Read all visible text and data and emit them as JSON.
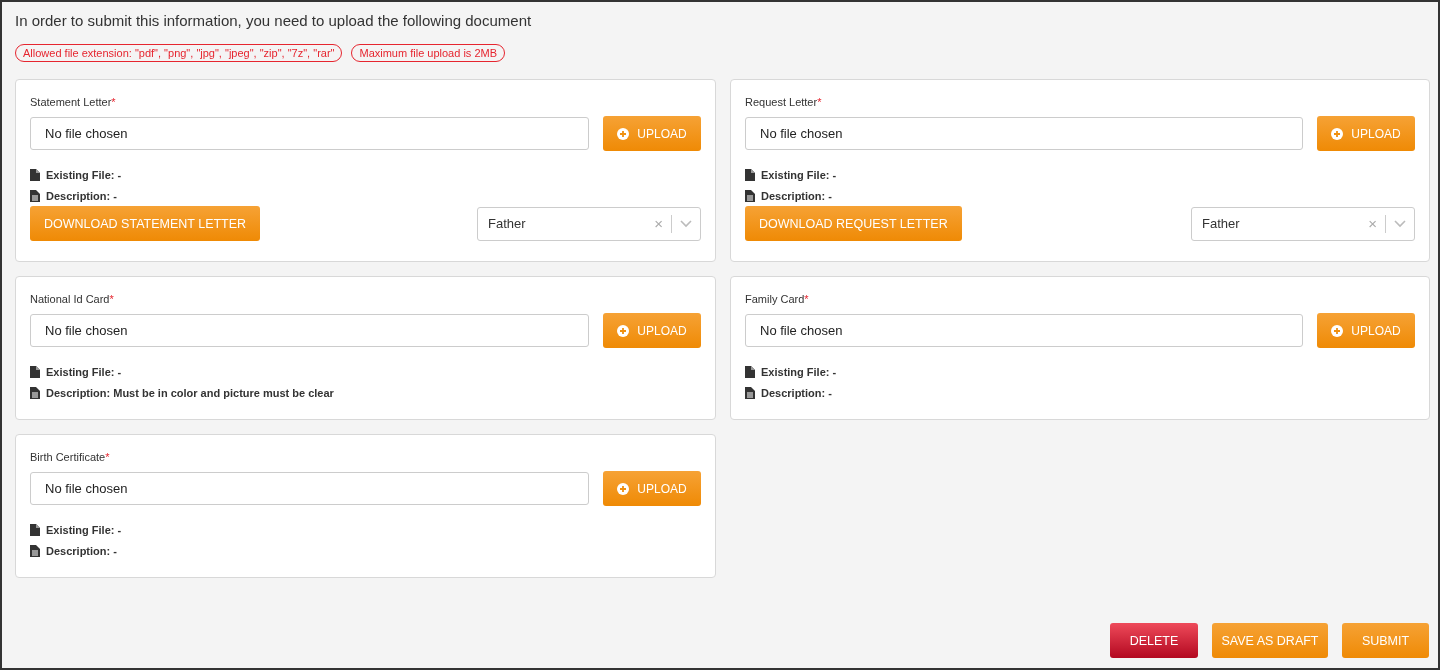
{
  "intro": "In order to submit this information, you need to upload the following document",
  "notices": [
    "Allowed file extension: \"pdf\", \"png\", \"jpg\", \"jpeg\", \"zip\", \"7z\", \"rar\"",
    "Maximum file upload is 2MB"
  ],
  "documents": [
    {
      "label": "Statement Letter",
      "required_mark": "*",
      "file_field": "No file chosen",
      "upload_button": "UPLOAD",
      "existing_file": "Existing File: -",
      "description": "Description: -",
      "download_button": "DOWNLOAD STATEMENT LETTER",
      "select_value": "Father",
      "select_clear": "×"
    },
    {
      "label": "Request Letter",
      "required_mark": "*",
      "file_field": "No file chosen",
      "upload_button": "UPLOAD",
      "existing_file": "Existing File: -",
      "description": "Description: -",
      "download_button": "DOWNLOAD REQUEST LETTER",
      "select_value": "Father",
      "select_clear": "×"
    },
    {
      "label": "National Id Card",
      "required_mark": "*",
      "file_field": "No file chosen",
      "upload_button": "UPLOAD",
      "existing_file": "Existing File: -",
      "description": "Description: Must be in color and picture must be clear"
    },
    {
      "label": "Family Card",
      "required_mark": "*",
      "file_field": "No file chosen",
      "upload_button": "UPLOAD",
      "existing_file": "Existing File: -",
      "description": "Description: -"
    },
    {
      "label": "Birth Certificate",
      "required_mark": "*",
      "file_field": "No file chosen",
      "upload_button": "UPLOAD",
      "existing_file": "Existing File: -",
      "description": "Description: -"
    }
  ],
  "actions": [
    {
      "label": "DELETE",
      "kind": "danger"
    },
    {
      "label": "SAVE AS DRAFT",
      "kind": "primary"
    },
    {
      "label": "SUBMIT",
      "kind": "primary"
    }
  ]
}
